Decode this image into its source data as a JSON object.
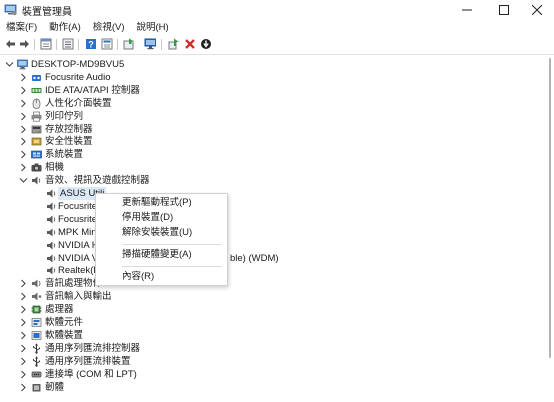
{
  "window": {
    "title": "裝置管理員",
    "icon": "device-manager-icon",
    "controls": [
      "minimize-icon",
      "maximize-icon",
      "close-icon"
    ]
  },
  "menu": [
    "檔案(F)",
    "動作(A)",
    "檢視(V)",
    "說明(H)"
  ],
  "toolbar": [
    "back-arrow-icon",
    "forward-arrow-icon",
    "properties-icon",
    "list-icon",
    "help-icon",
    "details-icon",
    "update-driver-icon",
    "scan-hardware-icon",
    "enable-device-icon",
    "uninstall-icon",
    "disable-icon"
  ],
  "tree": {
    "root": "DESKTOP-MD9BVU5",
    "items": [
      {
        "label": "Focusrite Audio",
        "icon": "audio-device-icon"
      },
      {
        "label": "IDE ATA/ATAPI 控制器",
        "icon": "ide-controller-icon"
      },
      {
        "label": "人性化介面裝置",
        "icon": "hid-icon"
      },
      {
        "label": "列印佇列",
        "icon": "printer-icon"
      },
      {
        "label": "存放控制器",
        "icon": "storage-controller-icon"
      },
      {
        "label": "安全性裝置",
        "icon": "security-device-icon"
      },
      {
        "label": "系統裝置",
        "icon": "system-device-icon"
      },
      {
        "label": "相機",
        "icon": "camera-icon"
      },
      {
        "label": "音效、視訊及遊戲控制器",
        "icon": "speaker-icon",
        "expanded": true
      },
      {
        "label": "ASUS Utili",
        "icon": "speaker-icon",
        "child": true,
        "selected": true
      },
      {
        "label": "Focusrite",
        "icon": "speaker-icon",
        "child": true
      },
      {
        "label": "Focusrite",
        "icon": "speaker-icon",
        "child": true
      },
      {
        "label": "MPK Min",
        "icon": "speaker-icon",
        "child": true
      },
      {
        "label": "NVIDIA H",
        "icon": "speaker-icon",
        "child": true
      },
      {
        "label": "NVIDIA V",
        "icon": "speaker-icon",
        "child": true,
        "tail": "ble) (WDM)"
      },
      {
        "label": "Realtek(R",
        "icon": "speaker-icon",
        "child": true
      },
      {
        "label": "音訊處理物件",
        "icon": "audio-processing-icon"
      },
      {
        "label": "音訊輸入與輸出",
        "icon": "audio-io-icon"
      },
      {
        "label": "處理器",
        "icon": "processor-icon"
      },
      {
        "label": "軟體元件",
        "icon": "software-component-icon"
      },
      {
        "label": "軟體裝置",
        "icon": "software-device-icon"
      },
      {
        "label": "通用序列匯流排控制器",
        "icon": "usb-controller-icon"
      },
      {
        "label": "通用序列匯流排裝置",
        "icon": "usb-device-icon"
      },
      {
        "label": "連接埠 (COM 和 LPT)",
        "icon": "port-icon"
      },
      {
        "label": "韌體",
        "icon": "firmware-icon"
      }
    ]
  },
  "context_menu": {
    "items": [
      "更新驅動程式(P)",
      "停用裝置(D)",
      "解除安裝裝置(U)",
      "掃描硬體變更(A)",
      "內容(R)"
    ]
  },
  "colors": {
    "selection": "#dbe8f7",
    "accent": "#2b6fc9",
    "close_red": "#d42a2a",
    "toolbar_green": "#2f9e44"
  }
}
